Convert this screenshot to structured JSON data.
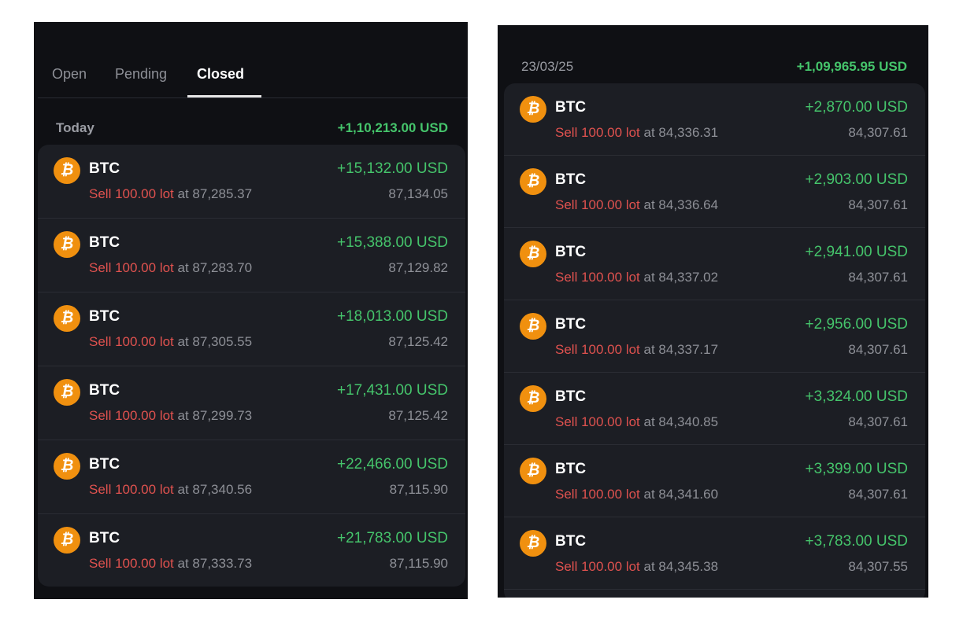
{
  "left": {
    "tabs": [
      {
        "label": "Open",
        "active": false
      },
      {
        "label": "Pending",
        "active": false
      },
      {
        "label": "Closed",
        "active": true
      }
    ],
    "group": {
      "date": "Today",
      "total": "+1,10,213.00 USD"
    },
    "trades": [
      {
        "symbol": "BTC",
        "side": "Sell",
        "lot": "100.00 lot",
        "at_text": "at 87,285.37",
        "pl": "+15,132.00 USD",
        "current": "87,134.05"
      },
      {
        "symbol": "BTC",
        "side": "Sell",
        "lot": "100.00 lot",
        "at_text": "at 87,283.70",
        "pl": "+15,388.00 USD",
        "current": "87,129.82"
      },
      {
        "symbol": "BTC",
        "side": "Sell",
        "lot": "100.00 lot",
        "at_text": "at 87,305.55",
        "pl": "+18,013.00 USD",
        "current": "87,125.42"
      },
      {
        "symbol": "BTC",
        "side": "Sell",
        "lot": "100.00 lot",
        "at_text": "at 87,299.73",
        "pl": "+17,431.00 USD",
        "current": "87,125.42"
      },
      {
        "symbol": "BTC",
        "side": "Sell",
        "lot": "100.00 lot",
        "at_text": "at 87,340.56",
        "pl": "+22,466.00 USD",
        "current": "87,115.90"
      },
      {
        "symbol": "BTC",
        "side": "Sell",
        "lot": "100.00 lot",
        "at_text": "at 87,333.73",
        "pl": "+21,783.00 USD",
        "current": "87,115.90"
      }
    ]
  },
  "right": {
    "group": {
      "date": "23/03/25",
      "total": "+1,09,965.95 USD"
    },
    "trades": [
      {
        "symbol": "BTC",
        "side": "Sell",
        "lot": "100.00 lot",
        "at_text": "at 84,336.31",
        "pl": "+2,870.00 USD",
        "current": "84,307.61"
      },
      {
        "symbol": "BTC",
        "side": "Sell",
        "lot": "100.00 lot",
        "at_text": "at 84,336.64",
        "pl": "+2,903.00 USD",
        "current": "84,307.61"
      },
      {
        "symbol": "BTC",
        "side": "Sell",
        "lot": "100.00 lot",
        "at_text": "at 84,337.02",
        "pl": "+2,941.00 USD",
        "current": "84,307.61"
      },
      {
        "symbol": "BTC",
        "side": "Sell",
        "lot": "100.00 lot",
        "at_text": "at 84,337.17",
        "pl": "+2,956.00 USD",
        "current": "84,307.61"
      },
      {
        "symbol": "BTC",
        "side": "Sell",
        "lot": "100.00 lot",
        "at_text": "at 84,340.85",
        "pl": "+3,324.00 USD",
        "current": "84,307.61"
      },
      {
        "symbol": "BTC",
        "side": "Sell",
        "lot": "100.00 lot",
        "at_text": "at 84,341.60",
        "pl": "+3,399.00 USD",
        "current": "84,307.61"
      },
      {
        "symbol": "BTC",
        "side": "Sell",
        "lot": "100.00 lot",
        "at_text": "at 84,345.38",
        "pl": "+3,783.00 USD",
        "current": "84,307.55"
      }
    ]
  },
  "coin_icon": {
    "name": "bitcoin-icon",
    "glyph": "₿",
    "color": "#f0900f"
  },
  "colors": {
    "profit": "#45c46b",
    "sell": "#e0524f",
    "background": "#0f1014",
    "card": "#1c1e24"
  }
}
